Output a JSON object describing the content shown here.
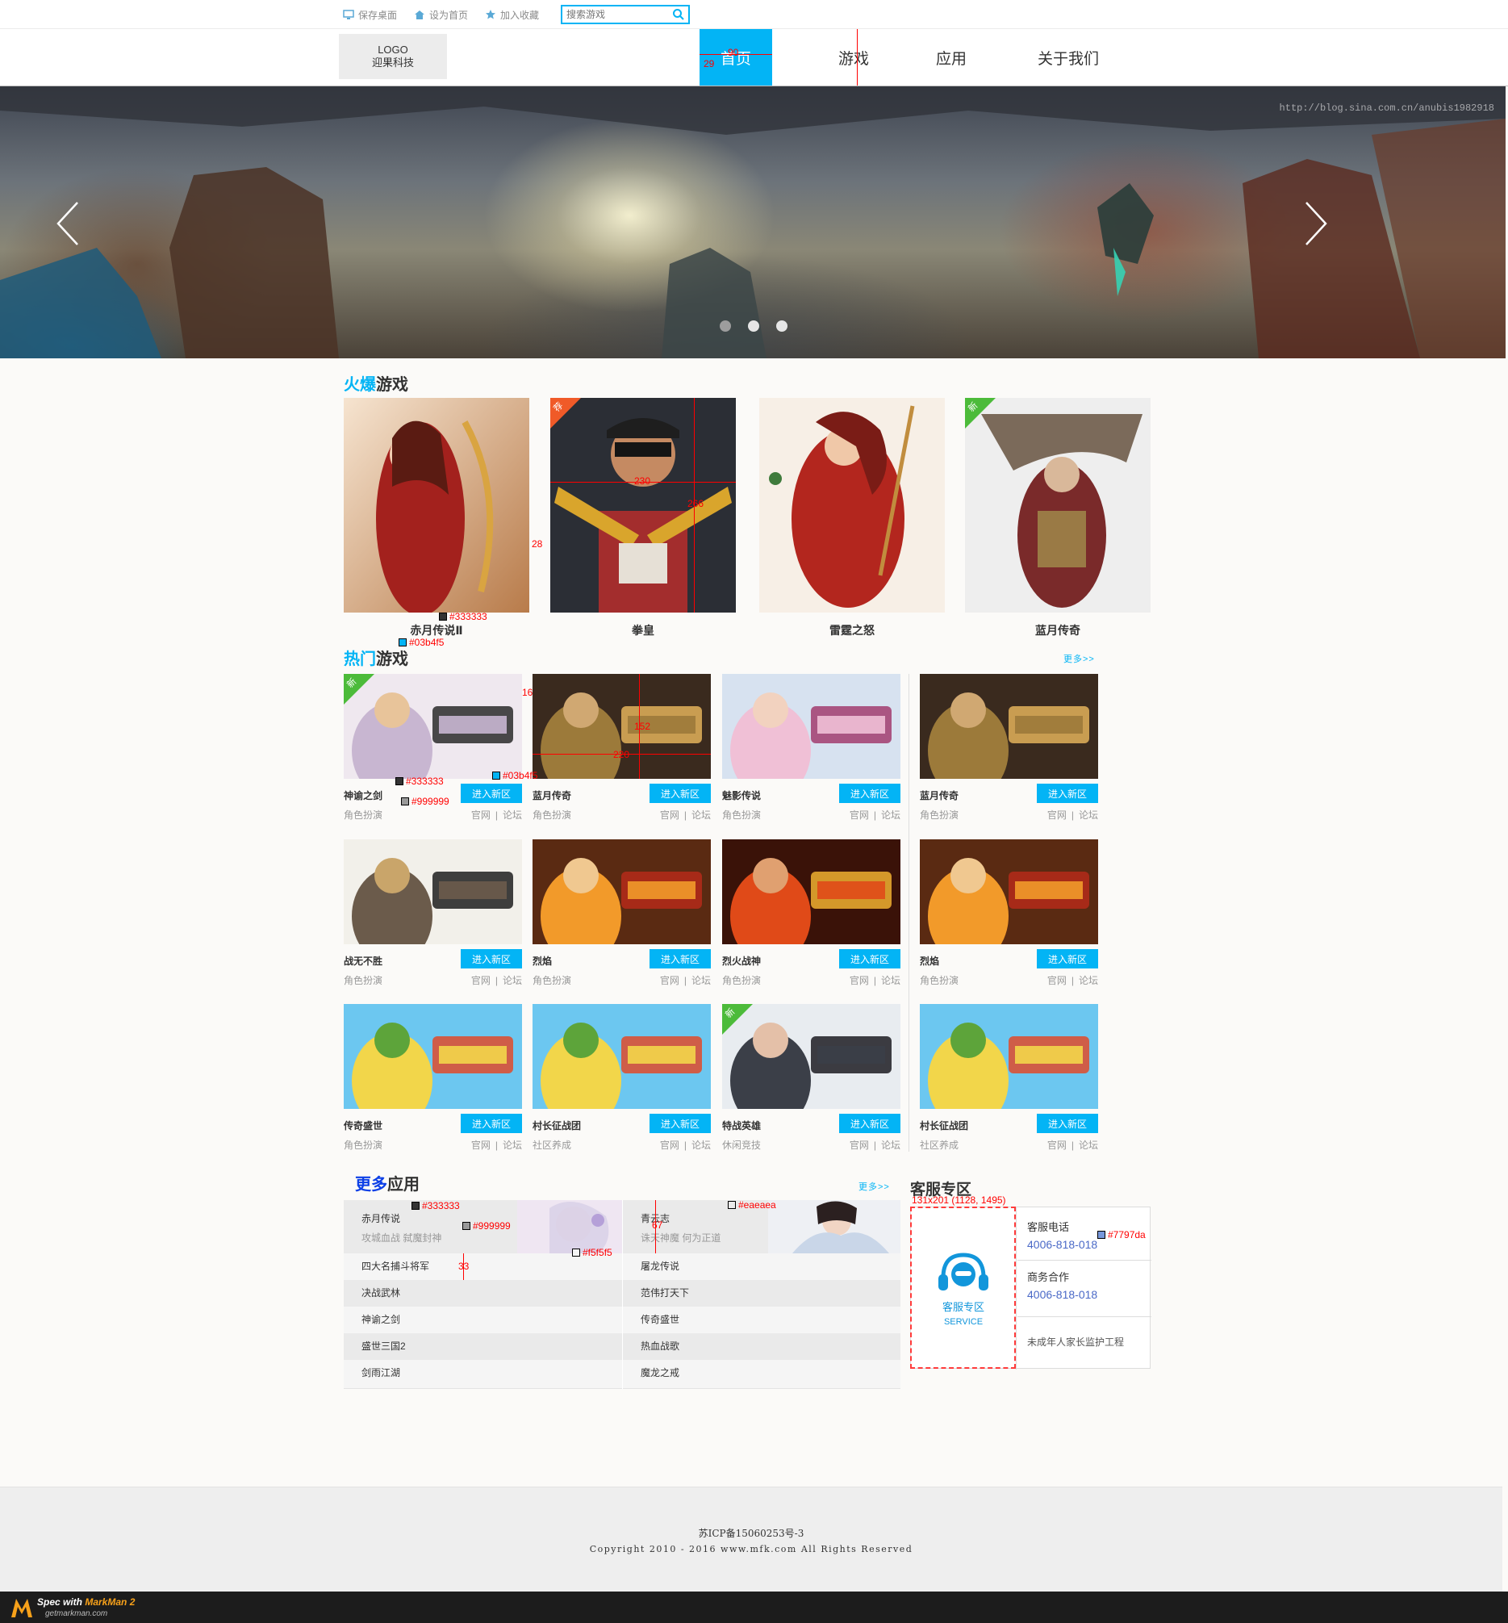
{
  "topbar": {
    "save_desktop": "保存桌面",
    "set_homepage": "设为首页",
    "add_favorite": "加入收藏",
    "search_placeholder": "搜索游戏"
  },
  "header": {
    "logo_line1": "LOGO",
    "logo_line2": "迎果科技",
    "nav": [
      "首页",
      "游戏",
      "应用",
      "关于我们"
    ],
    "active_nav": "首页"
  },
  "banner": {
    "watermark": "http://blog.sina.com.cn/anubis1982918",
    "slides_total": 3,
    "active_slide": 1
  },
  "hot": {
    "title_highlight": "火爆",
    "title_rest": "游戏",
    "games": [
      {
        "name": "赤月传说Ⅱ",
        "badge": ""
      },
      {
        "name": "拳皇",
        "badge": "荐"
      },
      {
        "name": "雷霆之怒",
        "badge": ""
      },
      {
        "name": "蓝月传奇",
        "badge": "新"
      }
    ]
  },
  "popular": {
    "title_highlight": "热门",
    "title_rest": "游戏",
    "more": "更多>>",
    "enter_btn": "进入新区",
    "link_official": "官网",
    "link_sep": "|",
    "link_forum": "论坛",
    "games": [
      {
        "name": "神谕之剑",
        "category": "角色扮演",
        "badge": "新",
        "art": "神谕之剑"
      },
      {
        "name": "蓝月传奇",
        "category": "角色扮演",
        "badge": "",
        "art": "蓝月传奇"
      },
      {
        "name": "魅影传说",
        "category": "角色扮演",
        "badge": "",
        "art": "魅影传说"
      },
      {
        "name": "蓝月传奇",
        "category": "角色扮演",
        "badge": "",
        "art": "蓝月传奇"
      },
      {
        "name": "战无不胜",
        "category": "角色扮演",
        "badge": "",
        "art": "战无不胜"
      },
      {
        "name": "烈焰",
        "category": "角色扮演",
        "badge": "",
        "art": "烈焰"
      },
      {
        "name": "烈火战神",
        "category": "角色扮演",
        "badge": "",
        "art": "烈火战神"
      },
      {
        "name": "烈焰",
        "category": "角色扮演",
        "badge": "",
        "art": "烈焰"
      },
      {
        "name": "传奇盛世",
        "category": "角色扮演",
        "badge": "",
        "art": "村长征战团"
      },
      {
        "name": "村长征战团",
        "category": "社区养成",
        "badge": "",
        "art": "村长征战团"
      },
      {
        "name": "特战英雄",
        "category": "休闲竞技",
        "badge": "新",
        "art": "特战英雄"
      },
      {
        "name": "村长征战团",
        "category": "社区养成",
        "badge": "",
        "art": "村长征战团"
      }
    ]
  },
  "apps": {
    "title_highlight": "更多",
    "title_rest": "应用",
    "more": "更多>>",
    "featured": [
      {
        "name": "赤月传说",
        "desc": "攻城血战 弑魔封神"
      },
      {
        "name": "青云志",
        "desc": "诛天神魔 何为正道"
      }
    ],
    "left_list": [
      "四大名捕斗将军",
      "决战武林",
      "神谕之剑",
      "盛世三国2",
      "剑雨江湖"
    ],
    "right_list": [
      "屠龙传说",
      "范伟打天下",
      "传奇盛世",
      "热血战歌",
      "魔龙之戒"
    ]
  },
  "service": {
    "title": "客服专区",
    "icon_label": "客服专区",
    "icon_sub": "SERVICE",
    "phone_label": "客服电话",
    "phone": "4006-818-018",
    "biz_label": "商务合作",
    "biz_phone": "4006-818-018",
    "guardian": "未成年人家长监护工程"
  },
  "footer": {
    "icp": "苏ICP备15060253号-3",
    "copyright": "Copyright  2010 - 2016 www.mfk.com All Rights Reserved"
  },
  "spec": {
    "c333": "#333333",
    "c03b": "#03b4f5",
    "c999": "#999999",
    "ceae": "#eaeaea",
    "cf5f": "#f5f5f5",
    "c779": "#7797da",
    "d90": "90",
    "d29": "29",
    "d230": "230",
    "d266": "266",
    "d28": "28",
    "d16": "16",
    "d152": "152",
    "d220": "220",
    "d67": "67",
    "d33": "33",
    "svc_box": "131x201 (1128, 1495)"
  },
  "markman": {
    "brand_prefix": "Spec with ",
    "brand": "MarkMan 2",
    "url": "getmarkman.com"
  },
  "colors": {
    "accent": "#03b4f5",
    "text": "#333333",
    "muted": "#999999",
    "list_alt": "#eaeaea",
    "list_bg": "#f5f5f5",
    "phone": "#7797da"
  }
}
